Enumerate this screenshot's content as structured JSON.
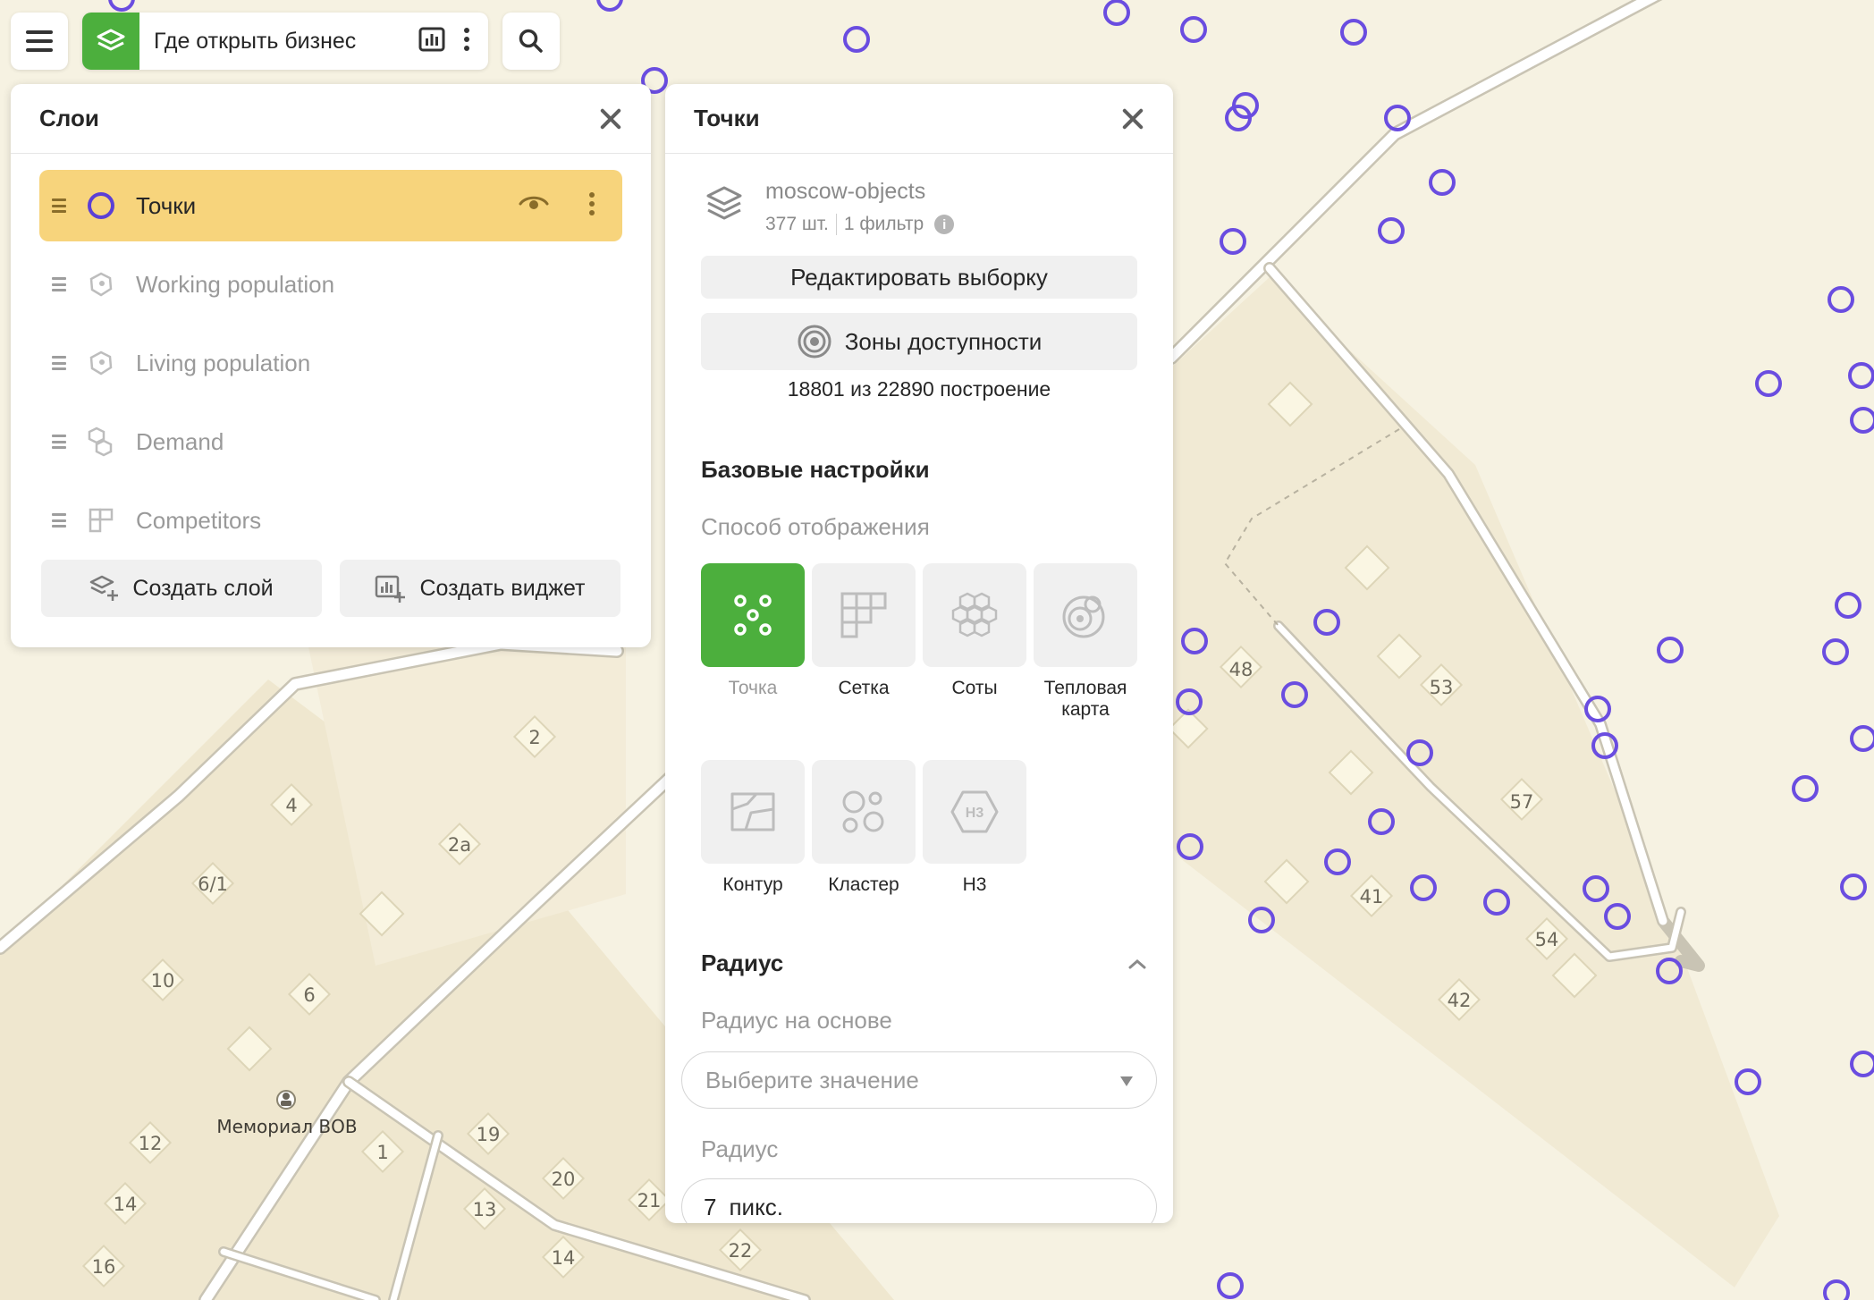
{
  "toolbar": {
    "project_title": "Где открыть бизнес"
  },
  "map": {
    "house_numbers": [
      "2",
      "4",
      "2а",
      "6/1",
      "10",
      "6",
      "12",
      "14",
      "16",
      "1",
      "19",
      "20",
      "21",
      "13",
      "14",
      "22",
      "48",
      "53",
      "57",
      "41",
      "54",
      "42"
    ],
    "poi_label": "Мемориал ВОВ",
    "marker_color": "#6a4de0"
  },
  "layers_panel": {
    "title": "Слои",
    "items": [
      {
        "label": "Точки",
        "icon": "circle-outline-icon",
        "active": true
      },
      {
        "label": "Working population",
        "icon": "population-icon",
        "active": false
      },
      {
        "label": "Living population",
        "icon": "population-icon",
        "active": false
      },
      {
        "label": "Demand",
        "icon": "hexagons-icon",
        "active": false
      },
      {
        "label": "Competitors",
        "icon": "grid-icon",
        "active": false
      }
    ],
    "create_layer_label": "Создать слой",
    "create_widget_label": "Создать виджет"
  },
  "points_panel": {
    "title": "Точки",
    "source_name": "moscow-objects",
    "count": "377 шт.",
    "filter_count": "1 фильтр",
    "edit_selection_label": "Редактировать выборку",
    "zones_label": "Зоны доступности",
    "build_quota": "18801 из 22890 построение",
    "basic_settings_title": "Базовые настройки",
    "display_mode_label": "Способ отображения",
    "display_modes": [
      {
        "label": "Точка",
        "icon": "dots-icon",
        "selected": true
      },
      {
        "label": "Сетка",
        "icon": "grid-icon",
        "selected": false
      },
      {
        "label": "Соты",
        "icon": "honeycomb-icon",
        "selected": false
      },
      {
        "label": "Тепловая карта",
        "icon": "heatmap-icon",
        "selected": false
      },
      {
        "label": "Контур",
        "icon": "contour-icon",
        "selected": false
      },
      {
        "label": "Кластер",
        "icon": "cluster-icon",
        "selected": false
      },
      {
        "label": "Н3",
        "icon": "h3-icon",
        "selected": false
      }
    ],
    "radius_section_title": "Радиус",
    "radius_basis_label": "Радиус на основе",
    "radius_basis_placeholder": "Выберите значение",
    "radius_label": "Радиус",
    "radius_value": "7",
    "radius_unit": "пикс."
  },
  "colors": {
    "accent_green": "#4caf3d",
    "active_layer_bg": "#f7d47c",
    "map_bg": "#f6f2e2"
  }
}
